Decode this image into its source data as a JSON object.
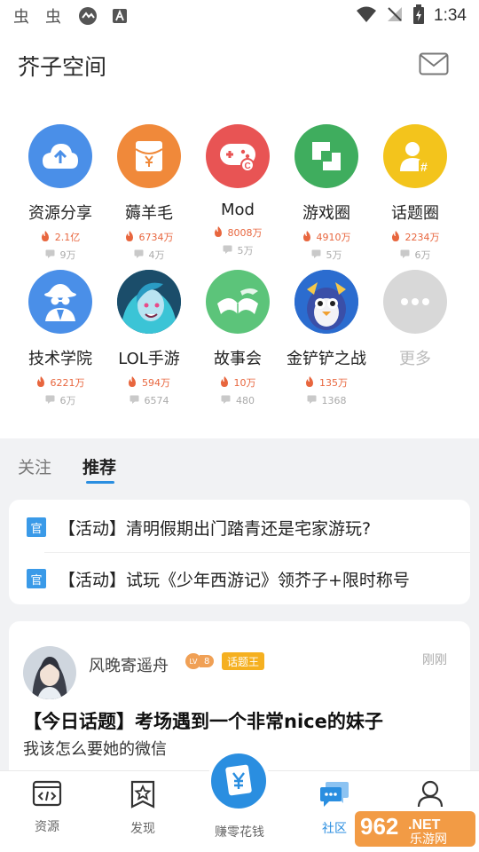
{
  "status_bar": {
    "time": "1:34",
    "left_icons": [
      "bug-icon",
      "bug-icon",
      "app-icon",
      "a-icon"
    ],
    "right_icons": [
      "wifi-icon",
      "no-signal-icon",
      "battery-icon"
    ]
  },
  "header": {
    "title": "芥子空间",
    "mail_icon": "mail-icon"
  },
  "categories": [
    {
      "name": "资源分享",
      "heat": "2.1亿",
      "comments": "9万",
      "color": "#4a8fe8",
      "icon": "cloud-upload-icon"
    },
    {
      "name": "薅羊毛",
      "heat": "6734万",
      "comments": "4万",
      "color": "#f0893a",
      "icon": "red-envelope-icon"
    },
    {
      "name": "Mod",
      "heat": "8008万",
      "comments": "5万",
      "color": "#e85454",
      "icon": "gamepad-icon"
    },
    {
      "name": "游戏圈",
      "heat": "4910万",
      "comments": "5万",
      "color": "#3fad5e",
      "icon": "frame-icon"
    },
    {
      "name": "话题圈",
      "heat": "2234万",
      "comments": "6万",
      "color": "#f3c41c",
      "icon": "topic-icon"
    },
    {
      "name": "技术学院",
      "heat": "6221万",
      "comments": "6万",
      "color": "#4a8fe8",
      "icon": "spy-icon"
    },
    {
      "name": "LOL手游",
      "heat": "594万",
      "comments": "6574",
      "color": "#2c8aa8",
      "icon": "lol-avatar-icon"
    },
    {
      "name": "故事会",
      "heat": "10万",
      "comments": "480",
      "color": "#5cc47a",
      "icon": "book-icon"
    },
    {
      "name": "金铲铲之战",
      "heat": "135万",
      "comments": "1368",
      "color": "#3a7fd6",
      "icon": "penguin-avatar-icon"
    },
    {
      "name": "更多",
      "heat": "",
      "comments": "",
      "color": "#d8d8d8",
      "icon": "more-icon"
    }
  ],
  "tabs": [
    {
      "label": "关注"
    },
    {
      "label": "推荐"
    }
  ],
  "notices": [
    {
      "badge": "官",
      "text": "【活动】清明假期出门踏青还是宅家游玩?"
    },
    {
      "badge": "官",
      "text": "【活动】试玩《少年西游记》领芥子+限时称号"
    }
  ],
  "post": {
    "username": "风晚寄遥舟",
    "level_prefix": "LV",
    "level": "8",
    "tag": "话题王",
    "time": "刚刚",
    "title": "【今日话题】考场遇到一个非常nice的妹子",
    "body": "我该怎么要她的微信"
  },
  "bottom_nav": {
    "items": [
      {
        "label": "资源",
        "icon": "code-icon"
      },
      {
        "label": "发现",
        "icon": "star-doc-icon"
      },
      {
        "label": "赚零花钱",
        "icon": "yen-card-icon"
      },
      {
        "label": "社区",
        "icon": "chat-icon"
      },
      {
        "label": "",
        "icon": "user-icon"
      }
    ],
    "active": "社区"
  },
  "watermark": {
    "text1": "962",
    "text2": ".NET",
    "text3": "乐游网"
  }
}
